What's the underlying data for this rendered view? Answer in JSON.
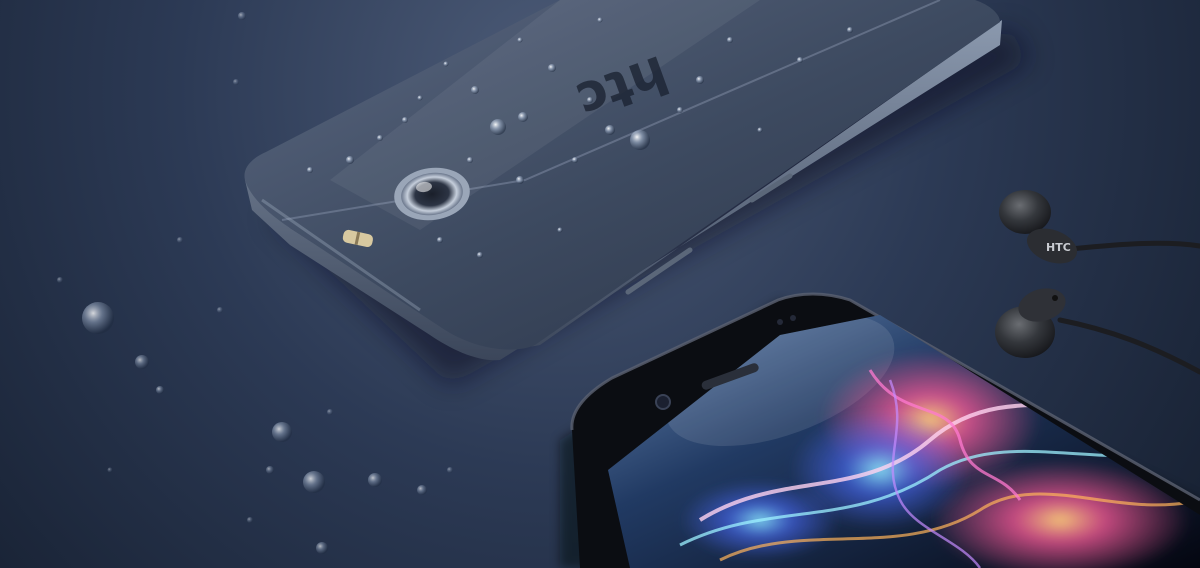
{
  "scene": {
    "subject": "product-photo",
    "back_logo_text": "htc",
    "earbud_logo_text": "HTC",
    "colors": {
      "background_light": "#4d5c78",
      "background_dark": "#141d2d",
      "phone_body": "#3d4a60",
      "phone_edge": "#8b99ae",
      "front_bezel": "#0b0d12",
      "earbud": "#26282c"
    }
  }
}
